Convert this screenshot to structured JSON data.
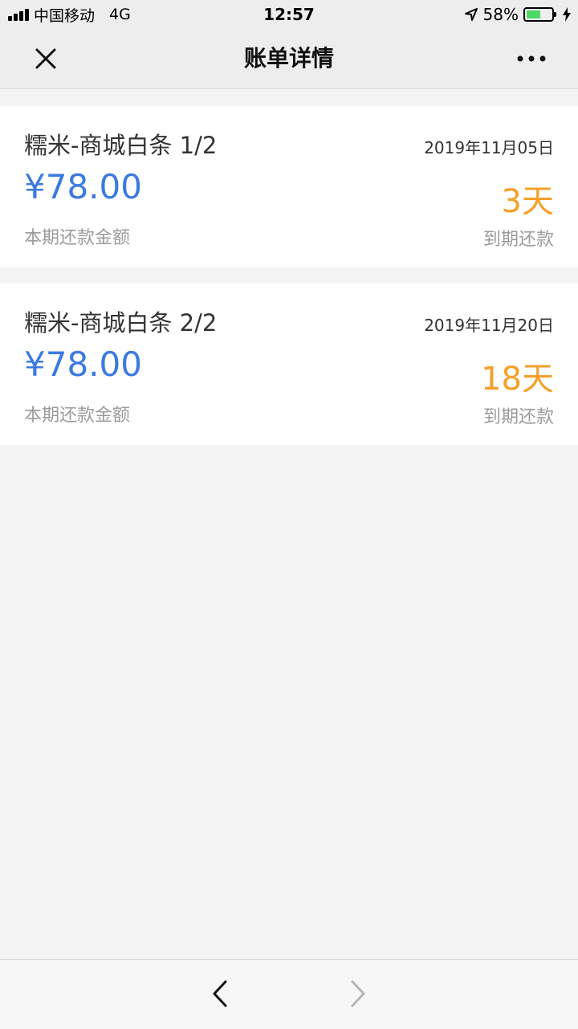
{
  "status_bar": {
    "carrier": "中国移动",
    "network": "4G",
    "time": "12:57",
    "battery_percent_text": "58%",
    "battery_level": 0.58,
    "battery_color": "#4cd964",
    "icons": [
      "signal-icon",
      "location-arrow-icon",
      "battery-icon",
      "charging-bolt-icon"
    ]
  },
  "nav": {
    "title": "账单详情",
    "close_icon": "close-icon",
    "more_icon": "more-dots-icon"
  },
  "bills": [
    {
      "title": "糯米-商城白条 1/2",
      "date": "2019年11月05日",
      "amount": "¥78.00",
      "amount_label": "本期还款金额",
      "days": "3天",
      "days_label": "到期还款"
    },
    {
      "title": "糯米-商城白条 2/2",
      "date": "2019年11月20日",
      "amount": "¥78.00",
      "amount_label": "本期还款金额",
      "days": "18天",
      "days_label": "到期还款"
    }
  ],
  "colors": {
    "amount": "#3b7ae0",
    "days": "#f5a02a",
    "label": "#9b9b9b",
    "background": "#f4f4f4"
  },
  "toolbar": {
    "back_icon": "chevron-left-icon",
    "forward_icon": "chevron-right-icon"
  }
}
